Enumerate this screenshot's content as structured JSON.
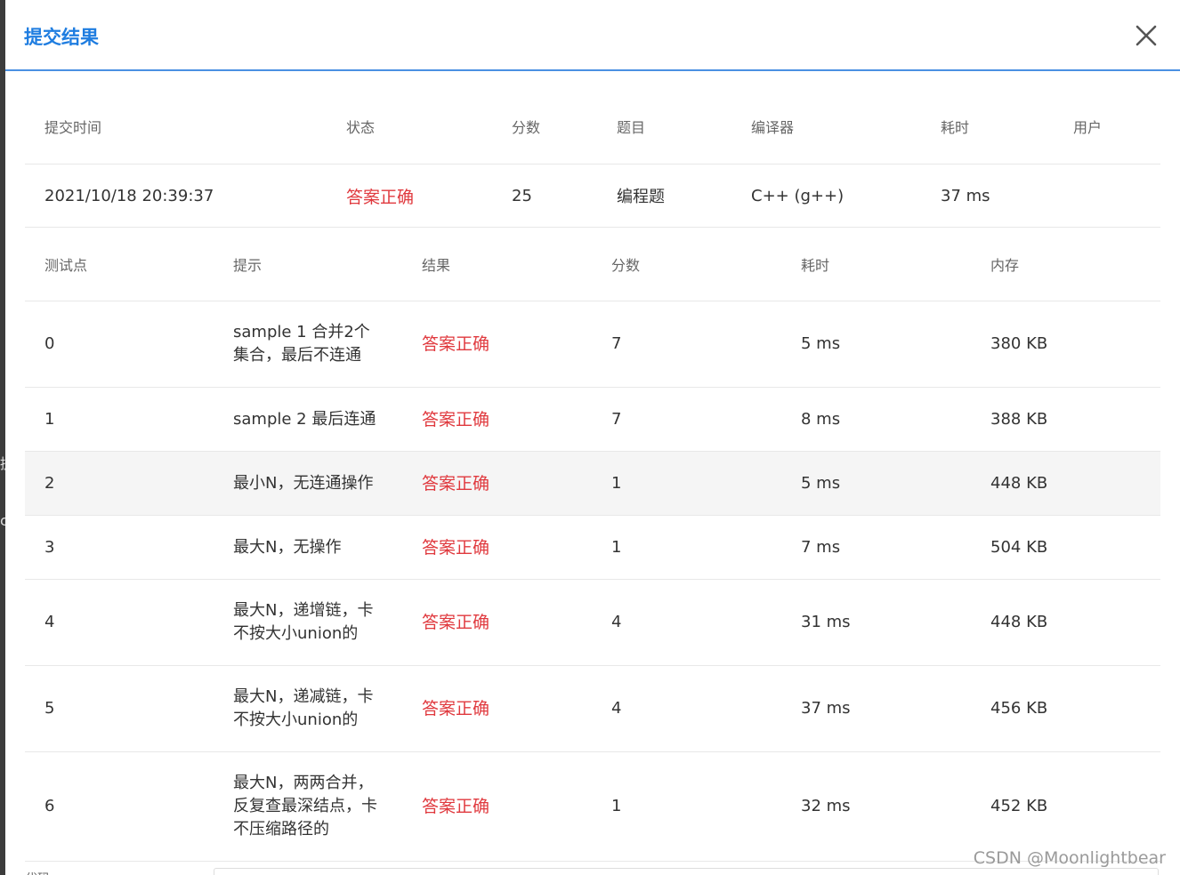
{
  "dialog": {
    "title": "提交结果"
  },
  "submission": {
    "headers": [
      "提交时间",
      "状态",
      "分数",
      "题目",
      "编译器",
      "耗时",
      "用户"
    ],
    "row": [
      "2021/10/18 20:39:37",
      "答案正确",
      "25",
      "编程题",
      "C++ (g++)",
      "37 ms",
      ""
    ]
  },
  "testcases": {
    "headers": [
      "测试点",
      "提示",
      "结果",
      "分数",
      "耗时",
      "内存"
    ],
    "rows": [
      {
        "id": "0",
        "hint": "sample 1 合并2个集合，最后不连通",
        "result": "答案正确",
        "score": "7",
        "time": "5 ms",
        "memory": "380 KB"
      },
      {
        "id": "1",
        "hint": "sample 2 最后连通",
        "result": "答案正确",
        "score": "7",
        "time": "8 ms",
        "memory": "388 KB"
      },
      {
        "id": "2",
        "hint": "最小N，无连通操作",
        "result": "答案正确",
        "score": "1",
        "time": "5 ms",
        "memory": "448 KB"
      },
      {
        "id": "3",
        "hint": "最大N，无操作",
        "result": "答案正确",
        "score": "1",
        "time": "7 ms",
        "memory": "504 KB"
      },
      {
        "id": "4",
        "hint": "最大N，递增链，卡不按大小union的",
        "result": "答案正确",
        "score": "4",
        "time": "31 ms",
        "memory": "448 KB"
      },
      {
        "id": "5",
        "hint": "最大N，递减链，卡不按大小union的",
        "result": "答案正确",
        "score": "4",
        "time": "37 ms",
        "memory": "456 KB"
      },
      {
        "id": "6",
        "hint": "最大N，两两合并，反复查最深结点，卡不压缩路径的",
        "result": "答案正确",
        "score": "1",
        "time": "32 ms",
        "memory": "452 KB"
      }
    ]
  },
  "watermark": "CSDN @Moonlightbear",
  "footer": {
    "hint": "代码"
  },
  "colors": {
    "accent": "#1f7de0",
    "header_rule": "#4a90e2",
    "accepted": "#e0393e",
    "hover_row": "#f5f5f5"
  },
  "icons": {
    "close": "close-icon"
  }
}
